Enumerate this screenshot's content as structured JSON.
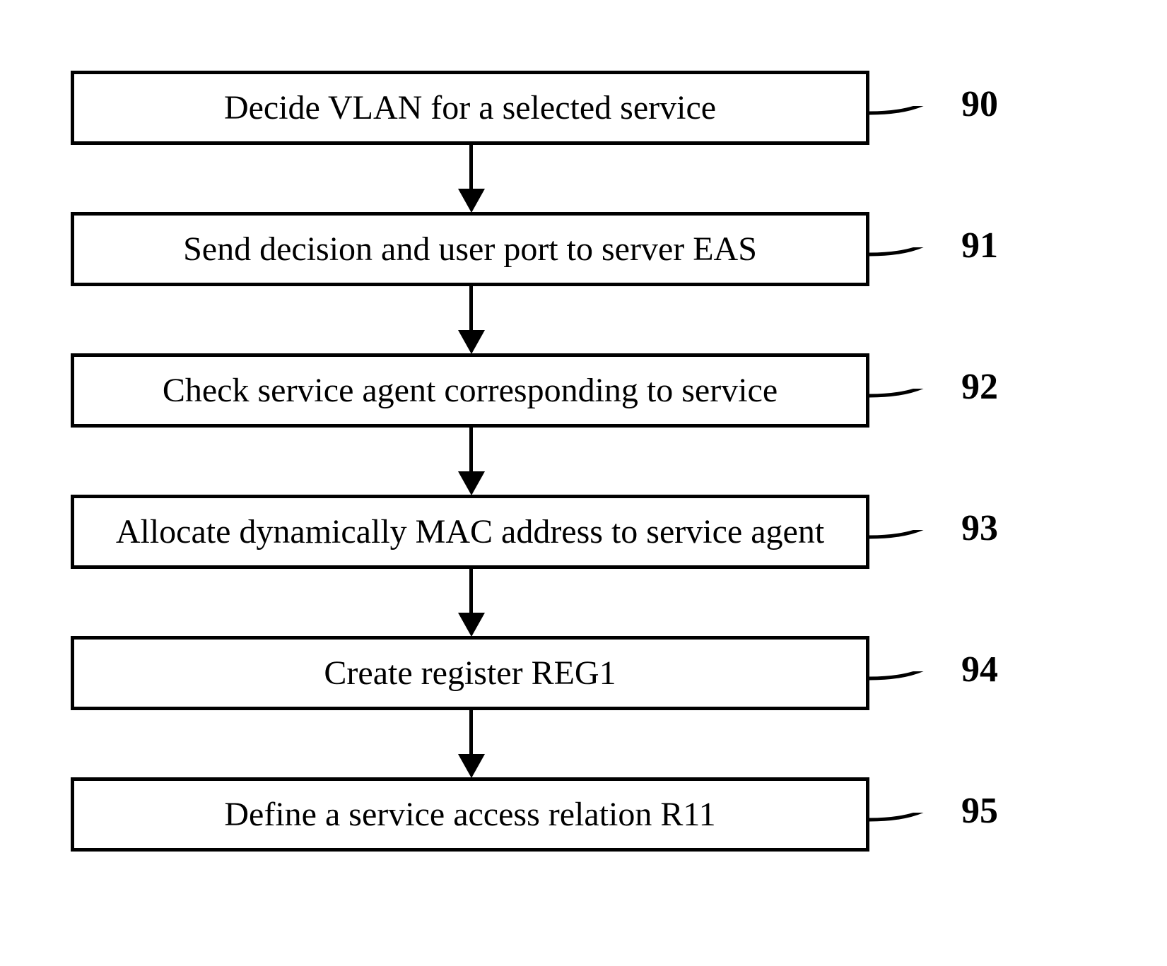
{
  "flowchart": {
    "steps": [
      {
        "label": "90",
        "text": "Decide VLAN for a selected service"
      },
      {
        "label": "91",
        "text": "Send decision and user port to server EAS"
      },
      {
        "label": "92",
        "text": "Check service agent corresponding to service"
      },
      {
        "label": "93",
        "text": "Allocate dynamically MAC address to service agent"
      },
      {
        "label": "94",
        "text": "Create register REG1"
      },
      {
        "label": "95",
        "text": "Define a service access relation R11"
      }
    ]
  }
}
